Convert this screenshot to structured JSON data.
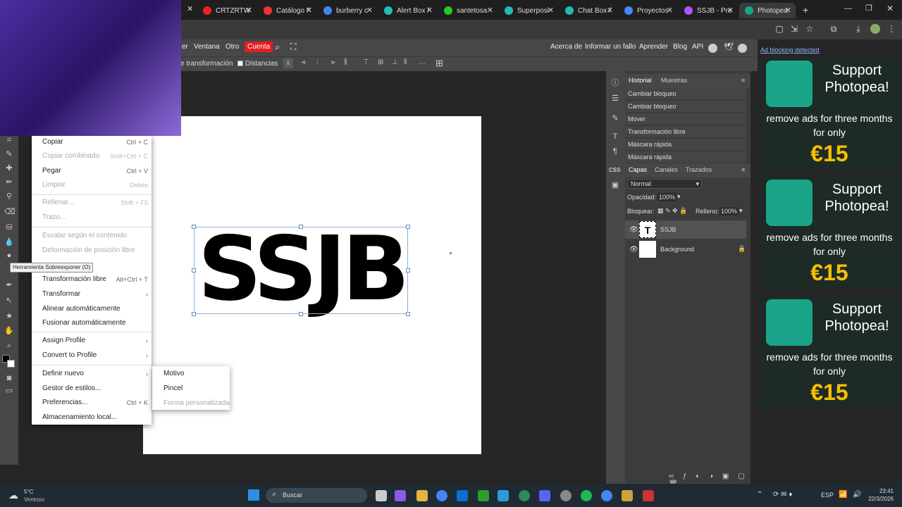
{
  "browser": {
    "tabs": [
      {
        "label": "CRTZRTW",
        "color": "#e22"
      },
      {
        "label": "Catálogo F",
        "color": "#e33"
      },
      {
        "label": "burberry c",
        "color": "#4285f4"
      },
      {
        "label": "Alert Box /",
        "color": "#2bb"
      },
      {
        "label": "santetosa",
        "color": "#2c2"
      },
      {
        "label": "Superposi",
        "color": "#2bb"
      },
      {
        "label": "Chat Box /",
        "color": "#2bb"
      },
      {
        "label": "Proyectos",
        "color": "#48f"
      },
      {
        "label": "SSJB - Pre",
        "color": "#a5f"
      },
      {
        "label": "Photopea",
        "color": "#1aa58a"
      }
    ],
    "new_tab": "+"
  },
  "menu": {
    "items_left": [
      "er",
      "Ventana",
      "Otro"
    ],
    "account": "Cuenta",
    "items_right": [
      "Acerca de",
      "Informar un fallo",
      "Aprender",
      "Blog",
      "API"
    ]
  },
  "optbar": {
    "transform_label": "e transformación",
    "distances_label": "Distancias"
  },
  "canvas": {
    "text": "SSJB"
  },
  "context_menu": {
    "items": [
      {
        "label": "Copiar",
        "shortcut": "Ctrl + C",
        "disabled": false
      },
      {
        "label": "Copiar combinado",
        "shortcut": "Shift+Ctrl + C",
        "disabled": true
      },
      {
        "label": "Pegar",
        "shortcut": "Ctrl + V",
        "disabled": false
      },
      {
        "label": "Limpiar",
        "shortcut": "Delete",
        "disabled": true
      },
      {
        "label": "Rellenar...",
        "shortcut": "Shift + F5",
        "disabled": true
      },
      {
        "label": "Trazo...",
        "shortcut": "",
        "disabled": true
      },
      {
        "label": "Escalar según el contenido",
        "shortcut": "",
        "disabled": true
      },
      {
        "label": "Deformación de posición libre",
        "shortcut": "",
        "disabled": true
      },
      {
        "label": "Transformación libre",
        "shortcut": "Alt+Ctrl + T",
        "disabled": false
      },
      {
        "label": "Transformar",
        "shortcut": "›",
        "disabled": false
      },
      {
        "label": "Alinear automáticamente",
        "shortcut": "",
        "disabled": false
      },
      {
        "label": "Fusionar automáticamente",
        "shortcut": "",
        "disabled": false
      },
      {
        "label": "Assign Profile",
        "shortcut": "›",
        "disabled": false
      },
      {
        "label": "Convert to Profile",
        "shortcut": "›",
        "disabled": false
      },
      {
        "label": "Definir nuevo",
        "shortcut": "›",
        "disabled": false
      },
      {
        "label": "Gestor de estilos...",
        "shortcut": "",
        "disabled": false
      },
      {
        "label": "Preferencias...",
        "shortcut": "Ctrl + K",
        "disabled": false
      },
      {
        "label": "Almacenamiento local...",
        "shortcut": "",
        "disabled": false
      }
    ],
    "submenu": [
      {
        "label": "Motivo",
        "disabled": false
      },
      {
        "label": "Pincel",
        "disabled": false
      },
      {
        "label": "Forma personalizada",
        "disabled": true
      }
    ]
  },
  "tooltip": "Herramienta Sobreexponer (O)",
  "history_panel": {
    "tabs": [
      "Historial",
      "Muestras"
    ],
    "entries": [
      "Cambiar bloqueo",
      "Cambiar bloqueo",
      "Mover",
      "Transformación libre",
      "Máscara rápida",
      "Máscara rápida"
    ]
  },
  "layers_panel": {
    "tabs": [
      "Capas",
      "Canales",
      "Trazados"
    ],
    "blend_mode": "Normal",
    "opacity_label": "Opacidad:",
    "opacity_value": "100%",
    "lock_label": "Bloquear:",
    "fill_label": "Relleno:",
    "fill_value": "100%",
    "layers": [
      {
        "name": "SSJB",
        "thumb": "T"
      },
      {
        "name": "Background",
        "thumb": ""
      }
    ]
  },
  "ads": {
    "header": "Ad blocking detected",
    "cards": [
      {
        "title": "Support Photopea!",
        "subtitle": "remove ads for three months for only",
        "price": "€15"
      },
      {
        "title": "Support Photopea!",
        "subtitle": "remove ads for three months for only",
        "price": "€15"
      },
      {
        "title": "Support Photopea!",
        "subtitle": "remove ads for three months for only",
        "price": "€15"
      }
    ]
  },
  "taskbar": {
    "weather_temp": "5°C",
    "weather_desc": "Ventoso",
    "search_placeholder": "Buscar",
    "lang": "ESP",
    "time": "23:41",
    "date": "22/3/2026"
  }
}
